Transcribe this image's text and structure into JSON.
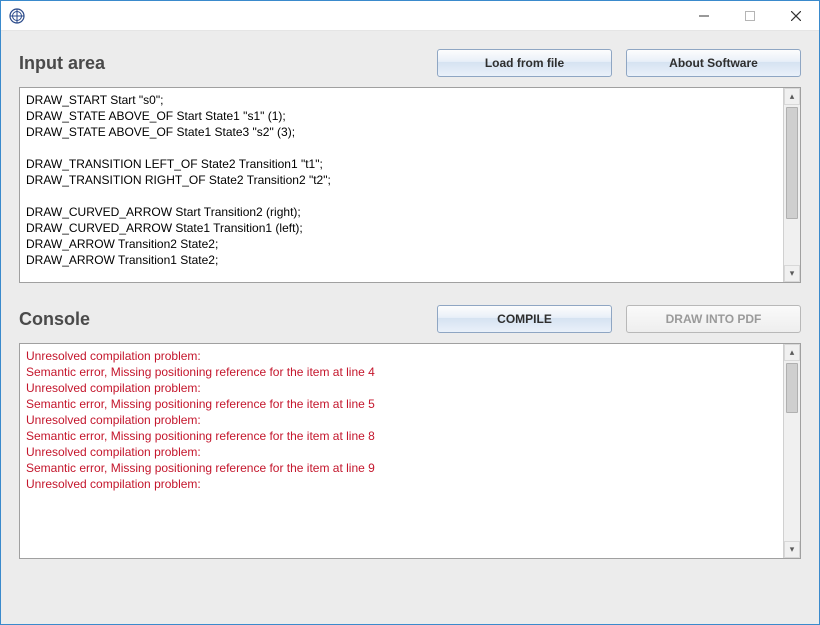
{
  "window": {
    "title": ""
  },
  "sections": {
    "input": {
      "title": "Input area",
      "buttons": {
        "load": "Load from file",
        "about": "About Software"
      },
      "code": "DRAW_START Start \"s0\";\nDRAW_STATE ABOVE_OF Start State1 \"s1\" (1);\nDRAW_STATE ABOVE_OF State1 State3 \"s2\" (3);\n\nDRAW_TRANSITION LEFT_OF State2 Transition1 \"t1\";\nDRAW_TRANSITION RIGHT_OF State2 Transition2 \"t2\";\n\nDRAW_CURVED_ARROW Start Transition2 (right);\nDRAW_CURVED_ARROW State1 Transition1 (left);\nDRAW_ARROW Transition2 State2;\nDRAW_ARROW Transition1 State2;"
    },
    "console": {
      "title": "Console",
      "buttons": {
        "compile": "COMPILE",
        "draw": "DRAW INTO PDF"
      },
      "lines": [
        "Unresolved compilation problem:",
        "Semantic error, Missing positioning reference for the item at line 4",
        "Unresolved compilation problem:",
        "Semantic error, Missing positioning reference for the item at line 5",
        "Unresolved compilation problem:",
        "Semantic error, Missing positioning reference for the item at line 8",
        "Unresolved compilation problem:",
        "Semantic error, Missing positioning reference for the item at line 9",
        "Unresolved compilation problem:"
      ]
    }
  }
}
